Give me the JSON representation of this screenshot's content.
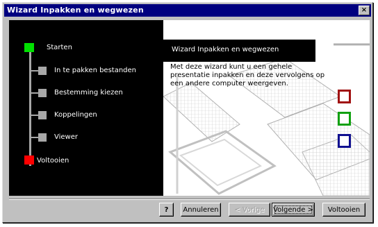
{
  "window": {
    "title": "Wizard Inpakken en wegwezen",
    "close_glyph": "×"
  },
  "steps": [
    {
      "label": "Starten",
      "state": "green",
      "color": "#00e000"
    },
    {
      "label": "In te pakken bestanden",
      "state": "gray"
    },
    {
      "label": "Bestemming kiezen",
      "state": "gray"
    },
    {
      "label": "Koppelingen",
      "state": "gray"
    },
    {
      "label": "Viewer",
      "state": "gray"
    },
    {
      "label": "Voltooien",
      "state": "red",
      "color": "#ff0000"
    }
  ],
  "content": {
    "header": "Wizard Inpakken en wegwezen",
    "description": "Met deze wizard kunt u een gehele presentatie inpakken en deze vervolgens op een andere computer weergeven."
  },
  "decor_squares": [
    {
      "name": "red",
      "color": "#a01010"
    },
    {
      "name": "green",
      "color": "#10a010"
    },
    {
      "name": "blue",
      "color": "#101090"
    }
  ],
  "buttons": {
    "help": "?",
    "cancel": "Annuleren",
    "back": "< Vorige",
    "next": "Volgende >",
    "finish": "Voltooien"
  }
}
